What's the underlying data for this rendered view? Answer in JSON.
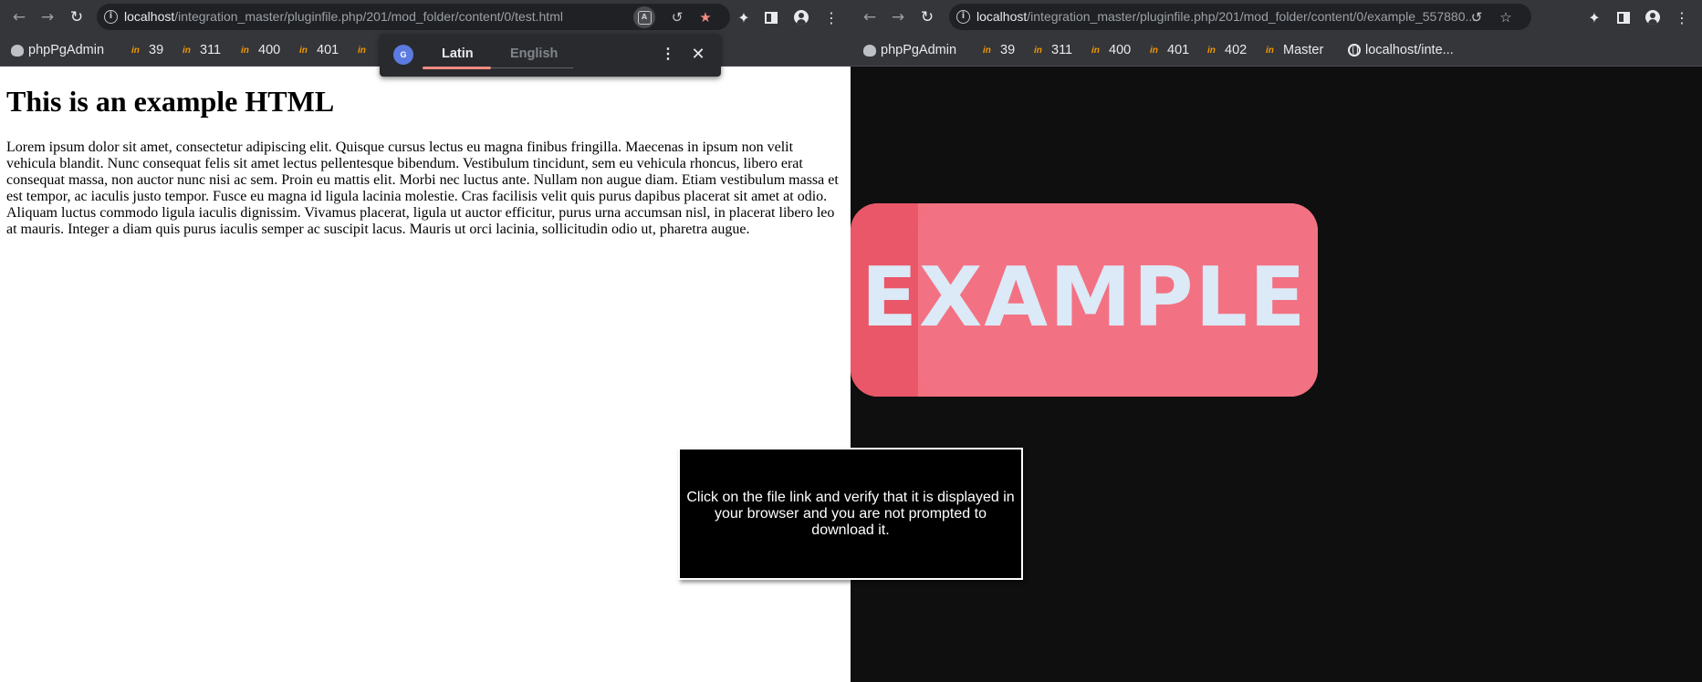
{
  "left_window": {
    "url_host": "localhost",
    "url_path": "/integration_master/pluginfile.php/201/mod_folder/content/0/test.html",
    "nav_icons": {
      "back": "arrow-left-icon",
      "forward": "arrow-right-icon",
      "reload": "reload-icon"
    },
    "bookmarks": [
      {
        "label": "phpPgAdmin",
        "icon": "elephant-icon"
      },
      {
        "label": "39",
        "icon": "in-icon"
      },
      {
        "label": "311",
        "icon": "in-icon"
      },
      {
        "label": "400",
        "icon": "in-icon"
      },
      {
        "label": "401",
        "icon": "in-icon"
      }
    ],
    "translate_popup": {
      "source_tab": "Latin",
      "target_tab": "English",
      "logo": "G"
    },
    "page": {
      "heading": "This is an example HTML",
      "paragraph": "Lorem ipsum dolor sit amet, consectetur adipiscing elit. Quisque cursus lectus eu magna finibus fringilla. Maecenas in ipsum non velit vehicula blandit. Nunc consequat felis sit amet lectus pellentesque bibendum. Vestibulum tincidunt, sem eu vehicula rhoncus, libero erat consequat massa, non auctor nunc nisi ac sem. Proin eu mattis elit. Morbi nec luctus ante. Nullam non augue diam. Etiam vestibulum massa et est tempor, ac iaculis justo tempor. Fusce eu magna id ligula lacinia molestie. Cras facilisis velit quis purus dapibus placerat sit amet at odio. Aliquam luctus commodo ligula iaculis dignissim. Vivamus placerat, ligula ut auctor efficitur, purus urna accumsan nisl, in placerat libero leo at mauris. Integer a diam quis purus iaculis semper ac suscipit lacus. Mauris ut orci lacinia, sollicitudin odio ut, pharetra augue."
    }
  },
  "right_window": {
    "url_host": "localhost",
    "url_path": "/integration_master/pluginfile.php/201/mod_folder/content/0/example_557880...",
    "bookmarks": [
      {
        "label": "phpPgAdmin",
        "icon": "elephant-icon"
      },
      {
        "label": "39",
        "icon": "in-icon"
      },
      {
        "label": "311",
        "icon": "in-icon"
      },
      {
        "label": "400",
        "icon": "in-icon"
      },
      {
        "label": "401",
        "icon": "in-icon"
      },
      {
        "label": "402",
        "icon": "in-icon"
      },
      {
        "label": "Master",
        "icon": "in-icon"
      },
      {
        "label": "localhost/inte...",
        "icon": "globe-icon"
      }
    ],
    "image": {
      "text": "EXAMPLE"
    }
  },
  "instruction": {
    "text": "Click on the file link and verify that it is displayed in your browser and you are not prompted to download it."
  },
  "colors": {
    "toolbar_bg": "#35363a",
    "omnibox_bg": "#202124",
    "badge_pink": "#f27283",
    "badge_shade": "#ea5768",
    "badge_text": "#dce9f7",
    "accent_red": "#f28b82"
  }
}
